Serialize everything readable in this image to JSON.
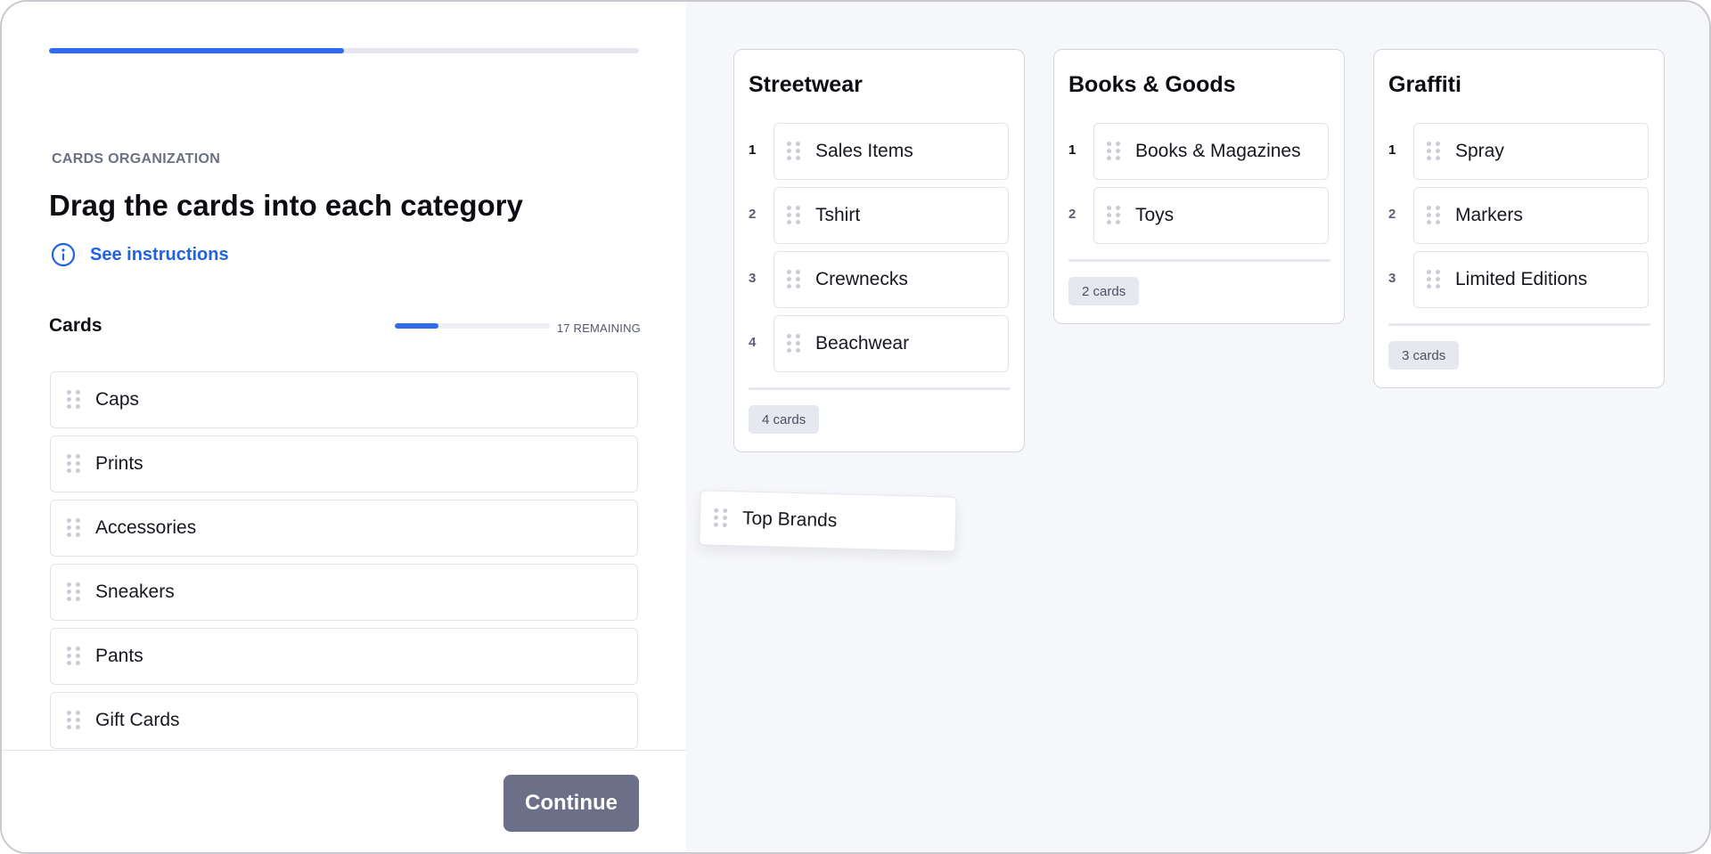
{
  "progress": {
    "overall_fraction": 0.5
  },
  "left": {
    "eyebrow": "CARDS ORGANIZATION",
    "title": "Drag the cards into each category",
    "instructions_label": "See instructions",
    "cards_title": "Cards",
    "remaining_text": "17 REMAINING",
    "cards_progress_fraction": 0.28,
    "cards": [
      {
        "label": "Caps"
      },
      {
        "label": "Prints"
      },
      {
        "label": "Accessories"
      },
      {
        "label": "Sneakers"
      },
      {
        "label": "Pants"
      },
      {
        "label": "Gift Cards"
      }
    ],
    "continue_label": "Continue"
  },
  "categories": [
    {
      "title": "Streetwear",
      "items": [
        {
          "num": "1",
          "label": "Sales Items"
        },
        {
          "num": "2",
          "label": "Tshirt"
        },
        {
          "num": "3",
          "label": "Crewnecks"
        },
        {
          "num": "4",
          "label": "Beachwear"
        }
      ],
      "count_label": "4 cards"
    },
    {
      "title": "Books & Goods",
      "items": [
        {
          "num": "1",
          "label": "Books & Magazines"
        },
        {
          "num": "2",
          "label": "Toys"
        }
      ],
      "count_label": "2 cards"
    },
    {
      "title": "Graffiti",
      "items": [
        {
          "num": "1",
          "label": "Spray"
        },
        {
          "num": "2",
          "label": "Markers"
        },
        {
          "num": "3",
          "label": "Limited Editions"
        }
      ],
      "count_label": "3 cards"
    }
  ],
  "dragging_card": {
    "label": "Top Brands"
  },
  "colors": {
    "accent": "#2f6bea",
    "link": "#1f63e0",
    "button": "#6b7088"
  }
}
